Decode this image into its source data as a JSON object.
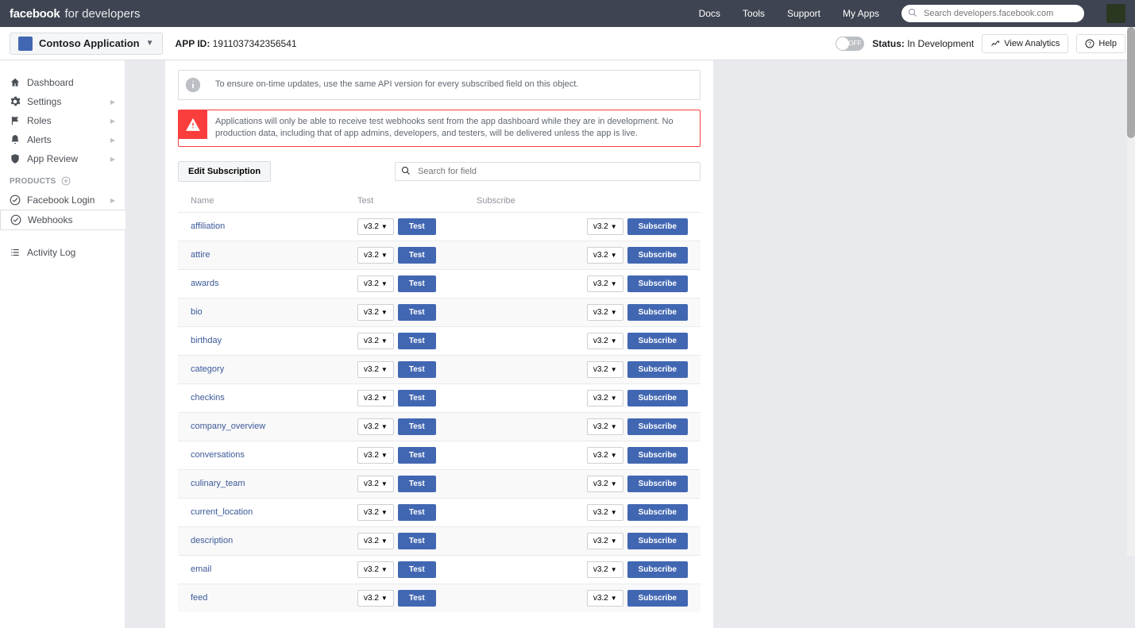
{
  "topbar": {
    "brand_bold": "facebook",
    "brand_light": "for developers",
    "nav": {
      "docs": "Docs",
      "tools": "Tools",
      "support": "Support",
      "myapps": "My Apps"
    },
    "search_placeholder": "Search developers.facebook.com"
  },
  "subbar": {
    "app_name": "Contoso Application",
    "app_id_label": "APP ID:",
    "app_id_value": "1911037342356541",
    "toggle": "OFF",
    "status_label": "Status:",
    "status_value": "In Development",
    "view_analytics": "View Analytics",
    "help": "Help"
  },
  "sidebar": {
    "items": [
      {
        "label": "Dashboard",
        "icon": "home"
      },
      {
        "label": "Settings",
        "icon": "gear"
      },
      {
        "label": "Roles",
        "icon": "flag"
      },
      {
        "label": "Alerts",
        "icon": "bell"
      },
      {
        "label": "App Review",
        "icon": "shield"
      }
    ],
    "products_header": "PRODUCTS",
    "products": [
      {
        "label": "Facebook Login",
        "icon": "check"
      },
      {
        "label": "Webhooks",
        "icon": "check",
        "active": true
      }
    ],
    "activity_log": "Activity Log"
  },
  "content": {
    "info_alert": "To ensure on-time updates, use the same API version for every subscribed field on this object.",
    "warn_alert": "Applications will only be able to receive test webhooks sent from the app dashboard while they are in development. No production data, including that of app admins, developers, and testers, will be delivered unless the app is live.",
    "edit_subscription": "Edit Subscription",
    "search_placeholder": "Search for field",
    "columns": {
      "name": "Name",
      "test": "Test",
      "subscribe": "Subscribe"
    },
    "version": "v3.2",
    "test_btn": "Test",
    "subscribe_btn": "Subscribe",
    "rows": [
      {
        "name": "affiliation"
      },
      {
        "name": "attire"
      },
      {
        "name": "awards"
      },
      {
        "name": "bio"
      },
      {
        "name": "birthday"
      },
      {
        "name": "category"
      },
      {
        "name": "checkins"
      },
      {
        "name": "company_overview"
      },
      {
        "name": "conversations"
      },
      {
        "name": "culinary_team"
      },
      {
        "name": "current_location"
      },
      {
        "name": "description"
      },
      {
        "name": "email"
      },
      {
        "name": "feed"
      }
    ]
  }
}
